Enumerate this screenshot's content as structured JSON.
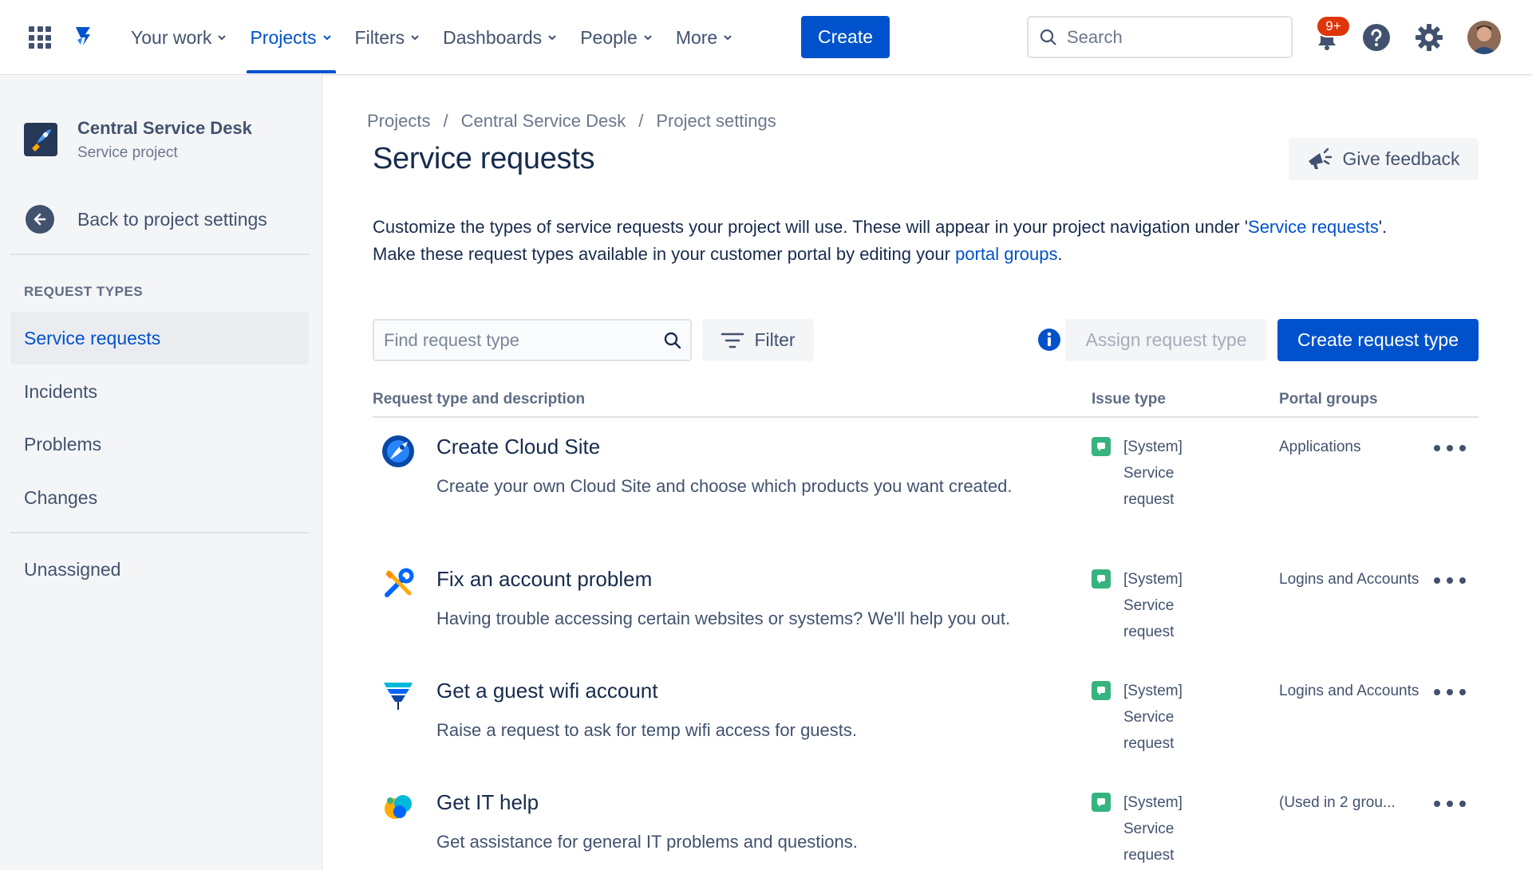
{
  "nav": {
    "items": [
      {
        "label": "Your work",
        "active": false
      },
      {
        "label": "Projects",
        "active": true
      },
      {
        "label": "Filters",
        "active": false
      },
      {
        "label": "Dashboards",
        "active": false
      },
      {
        "label": "People",
        "active": false
      },
      {
        "label": "More",
        "active": false
      }
    ],
    "create_label": "Create",
    "search_placeholder": "Search",
    "notification_badge": "9+"
  },
  "sidebar": {
    "project_name": "Central Service Desk",
    "project_type": "Service project",
    "back_label": "Back to project settings",
    "section_heading": "REQUEST TYPES",
    "items": [
      {
        "label": "Service requests",
        "active": true
      },
      {
        "label": "Incidents",
        "active": false
      },
      {
        "label": "Problems",
        "active": false
      },
      {
        "label": "Changes",
        "active": false
      }
    ],
    "unassigned_label": "Unassigned"
  },
  "main": {
    "breadcrumb": [
      "Projects",
      "Central Service Desk",
      "Project settings"
    ],
    "breadcrumb_sep": "/",
    "title": "Service requests",
    "feedback_label": "Give feedback",
    "desc": {
      "part1": "Customize the types of service requests your project will use. These will appear in your project navigation under '",
      "link1": "Service requests",
      "part2": "'.",
      "part3": "Make these request types available in your customer portal by editing your ",
      "link2": "portal groups",
      "part4": "."
    },
    "find_placeholder": "Find request type",
    "filter_label": "Filter",
    "assign_label": "Assign request type",
    "create_type_label": "Create request type",
    "columns": {
      "request": "Request type and description",
      "issue": "Issue type",
      "portal": "Portal groups"
    },
    "rows": [
      {
        "icon": "rocket-globe-icon",
        "title": "Create Cloud Site",
        "desc": "Create your own Cloud Site and choose which products you want created.",
        "issue": "[System] Service request",
        "portal": "Applications"
      },
      {
        "icon": "tools-icon",
        "title": "Fix an account problem",
        "desc": "Having trouble accessing certain websites or systems? We'll help you out.",
        "issue": "[System] Service request",
        "portal": "Logins and Accounts"
      },
      {
        "icon": "wifi-funnel-icon",
        "title": "Get a guest wifi account",
        "desc": "Raise a request to ask for temp wifi access for guests.",
        "issue": "[System] Service request",
        "portal": "Logins and Accounts"
      },
      {
        "icon": "chat-bubbles-icon",
        "title": "Get IT help",
        "desc": "Get assistance for general IT problems and questions.",
        "issue": "[System] Service request",
        "portal": "(Used in 2 grou..."
      }
    ]
  },
  "colors": {
    "brand": "#0052CC",
    "text": "#172B4D",
    "subtle": "#42526E",
    "sidebar_bg": "#F4F5F7",
    "service_request_green": "#36B37E",
    "badge_red": "#DE350B"
  }
}
